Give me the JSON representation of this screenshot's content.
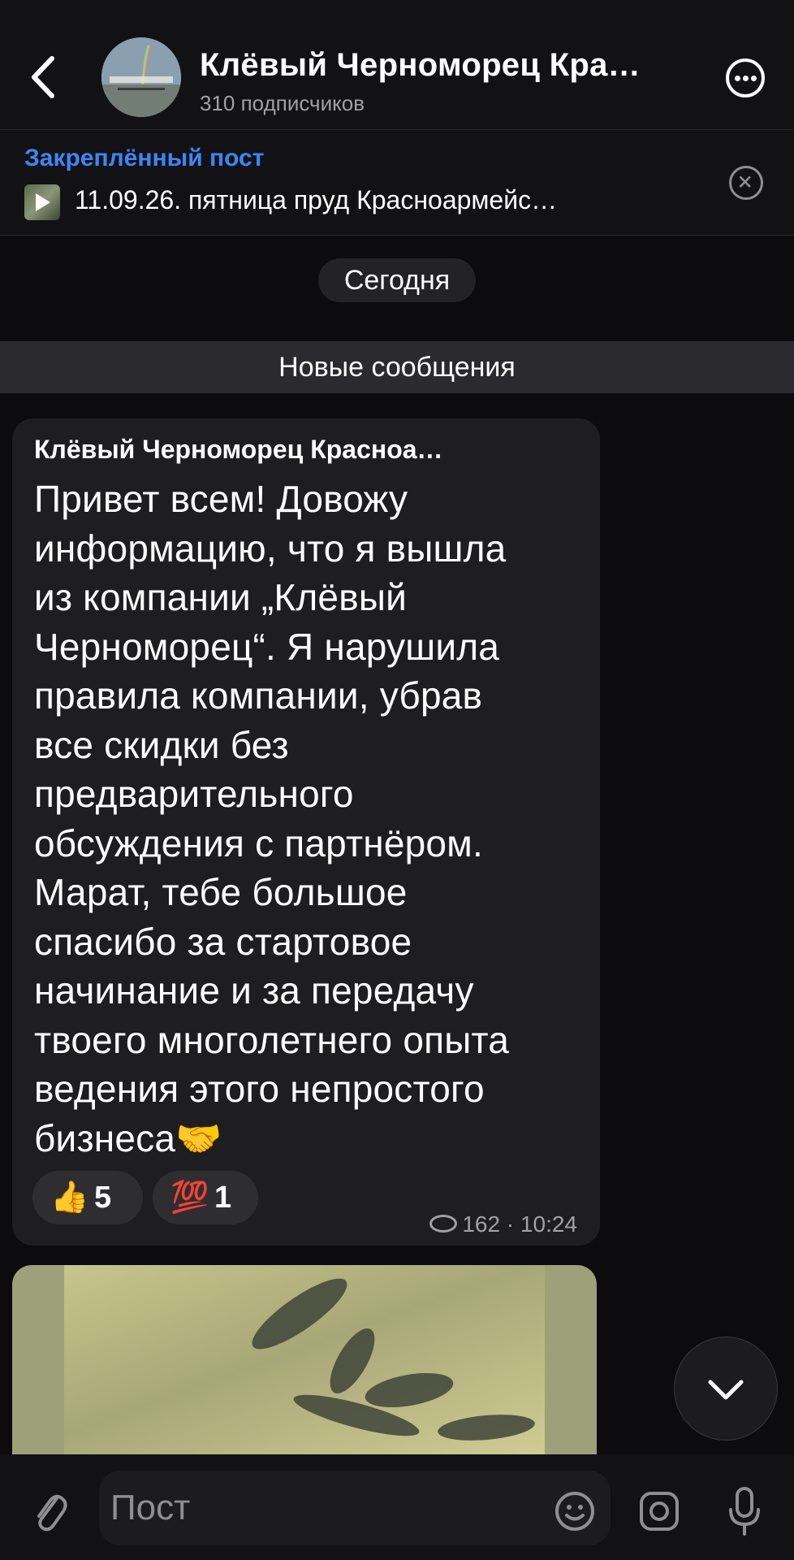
{
  "header": {
    "channel_title": "Клёвый Черноморец Кра…",
    "subscribers": "310 подписчиков"
  },
  "pinned": {
    "label": "Закреплённый пост",
    "text": "11.09.26. пятница пруд Красноармейс…"
  },
  "chat": {
    "date_label": "Сегодня",
    "new_messages_label": "Новые сообщения"
  },
  "message": {
    "author": "Клёвый Черноморец Красноа…",
    "text": "Привет всем! Довожу\nинформацию, что я вышла\nиз компании „Клёвый\nЧерноморец“. Я нарушила\nправила компании, убрав\nвсе скидки без\nпредварительного\nобсуждения с партнёром.\nМарат, тебе большое\nспасибо за стартовое\nначинание и за передачу\nтвоего многолетнего опыта\nведения этого непростого\nбизнеса🤝",
    "reactions": [
      {
        "emoji": "👍",
        "count": "5"
      },
      {
        "emoji": "💯",
        "count": "1"
      }
    ],
    "views": "162",
    "time": "10:24"
  },
  "composer": {
    "placeholder": "Пост"
  },
  "colors": {
    "background": "#0c0c0e",
    "accent": "#3d86f5",
    "bubble": "#1e1e20"
  }
}
